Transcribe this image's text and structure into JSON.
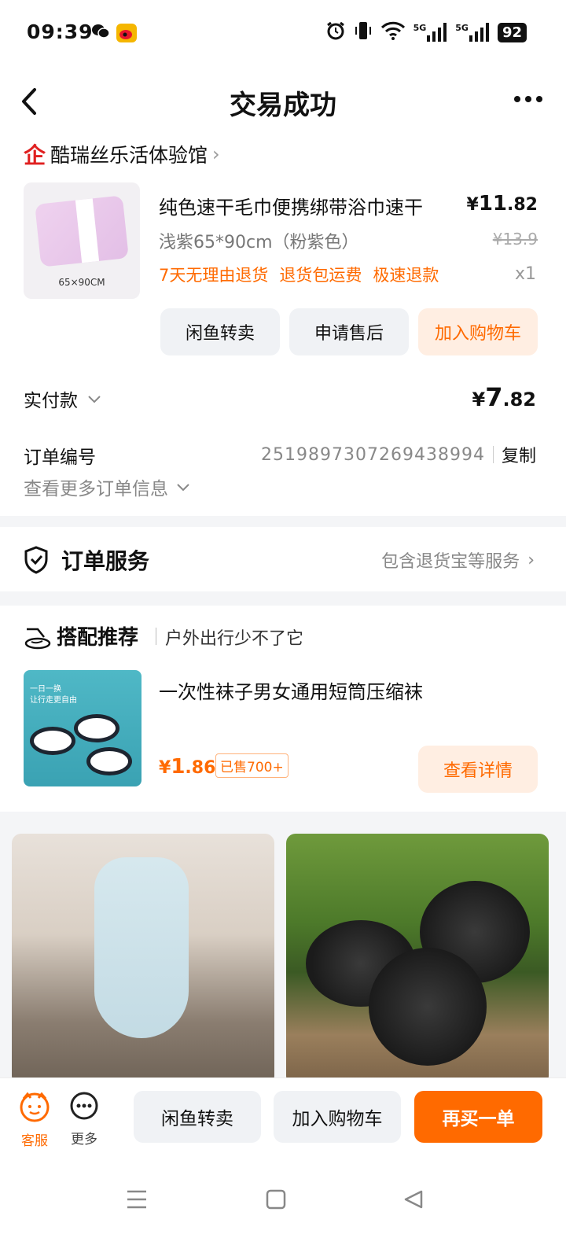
{
  "status_bar": {
    "time": "09:39",
    "battery": "92",
    "signal1": "5G",
    "signal2": "5G"
  },
  "nav": {
    "title": "交易成功"
  },
  "shop": {
    "icon_text": "企",
    "name": "酷瑞丝乐活体验馆"
  },
  "product": {
    "thumb_caption": "65×90CM",
    "name": "纯色速干毛巾便携绑带浴巾速干",
    "price_symbol": "¥",
    "price_int": "11",
    "price_dec": ".82",
    "sku": "浅紫65*90cm（粉紫色）",
    "original_price": "¥13.9",
    "tags": [
      "7天无理由退货",
      "退货包运费",
      "极速退款"
    ],
    "qty": "x1"
  },
  "product_actions": {
    "resell": "闲鱼转卖",
    "after_sale": "申请售后",
    "add_cart": "加入购物车"
  },
  "payment": {
    "label": "实付款",
    "symbol": "¥",
    "int": "7",
    "dec": ".82"
  },
  "order": {
    "label": "订单编号",
    "number": "2519897307269438994",
    "copy": "复制",
    "more_info": "查看更多订单信息"
  },
  "service": {
    "title": "订单服务",
    "desc": "包含退货宝等服务"
  },
  "recommend": {
    "title": "搭配推荐",
    "subtitle": "户外出行少不了它",
    "thumb_slogan1": "一日一换",
    "thumb_slogan2": "让行走更自由",
    "item_name": "一次性袜子男女通用短筒压缩袜",
    "price_symbol": "¥",
    "price_int": "1",
    "price_dec": ".86",
    "sold": "已售700+",
    "detail": "查看详情"
  },
  "bottom_bar": {
    "service": "客服",
    "more": "更多",
    "resell": "闲鱼转卖",
    "add_cart": "加入购物车",
    "rebuy": "再买一单"
  },
  "colors": {
    "accent": "#ff6a00",
    "accent_light": "#ffeee2",
    "brand_red": "#e02020"
  }
}
